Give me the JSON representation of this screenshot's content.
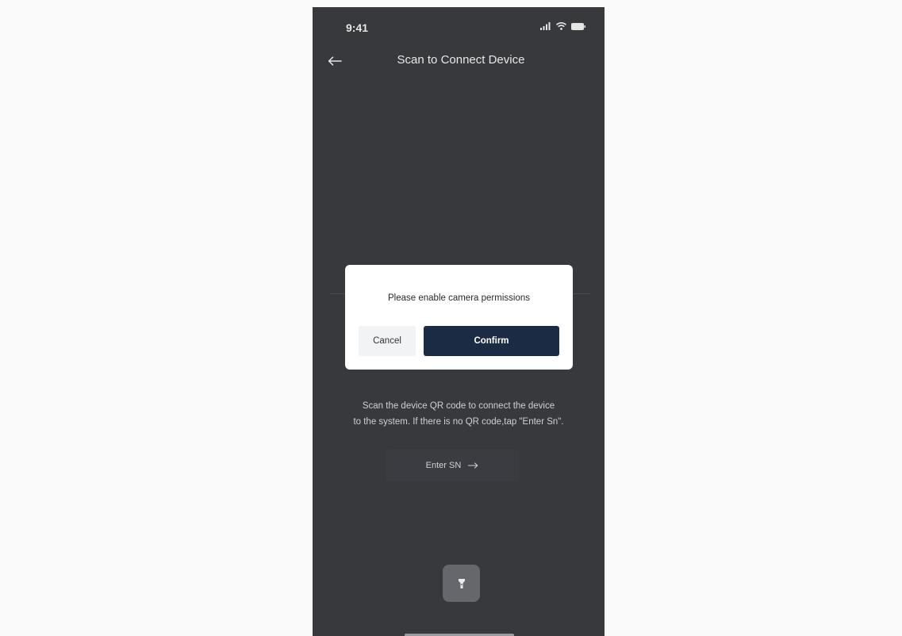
{
  "status_bar": {
    "time": "9:41",
    "icons": [
      "signal-icon",
      "wifi-icon",
      "battery-icon"
    ]
  },
  "nav": {
    "back_icon": "back-arrow-icon",
    "title": "Scan to Connect Device"
  },
  "dialog": {
    "message": "Please enable camera permissions",
    "cancel_label": "Cancel",
    "confirm_label": "Confirm"
  },
  "instructions": {
    "line1": "Scan the device QR code to connect the device",
    "line2": "to the system.  If there is no QR code,tap \"Enter Sn\"."
  },
  "enter_sn": {
    "label": "Enter SN",
    "icon": "arrow-right-icon"
  },
  "flashlight": {
    "icon": "flashlight-icon"
  },
  "colors": {
    "screen_background": "#38393d",
    "confirm_button": "#1c2b44",
    "cancel_button": "#f2f3f5",
    "dialog_background": "#ffffff"
  }
}
